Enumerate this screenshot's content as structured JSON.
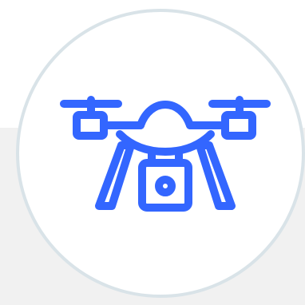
{
  "icon": {
    "name": "drone-icon",
    "stroke_color": "#3366ff"
  },
  "badge": {
    "border_color": "#d9e3e8",
    "fill_color": "#ffffff"
  },
  "background": {
    "panel_color": "#f1f1f1",
    "page_color": "#ffffff"
  }
}
